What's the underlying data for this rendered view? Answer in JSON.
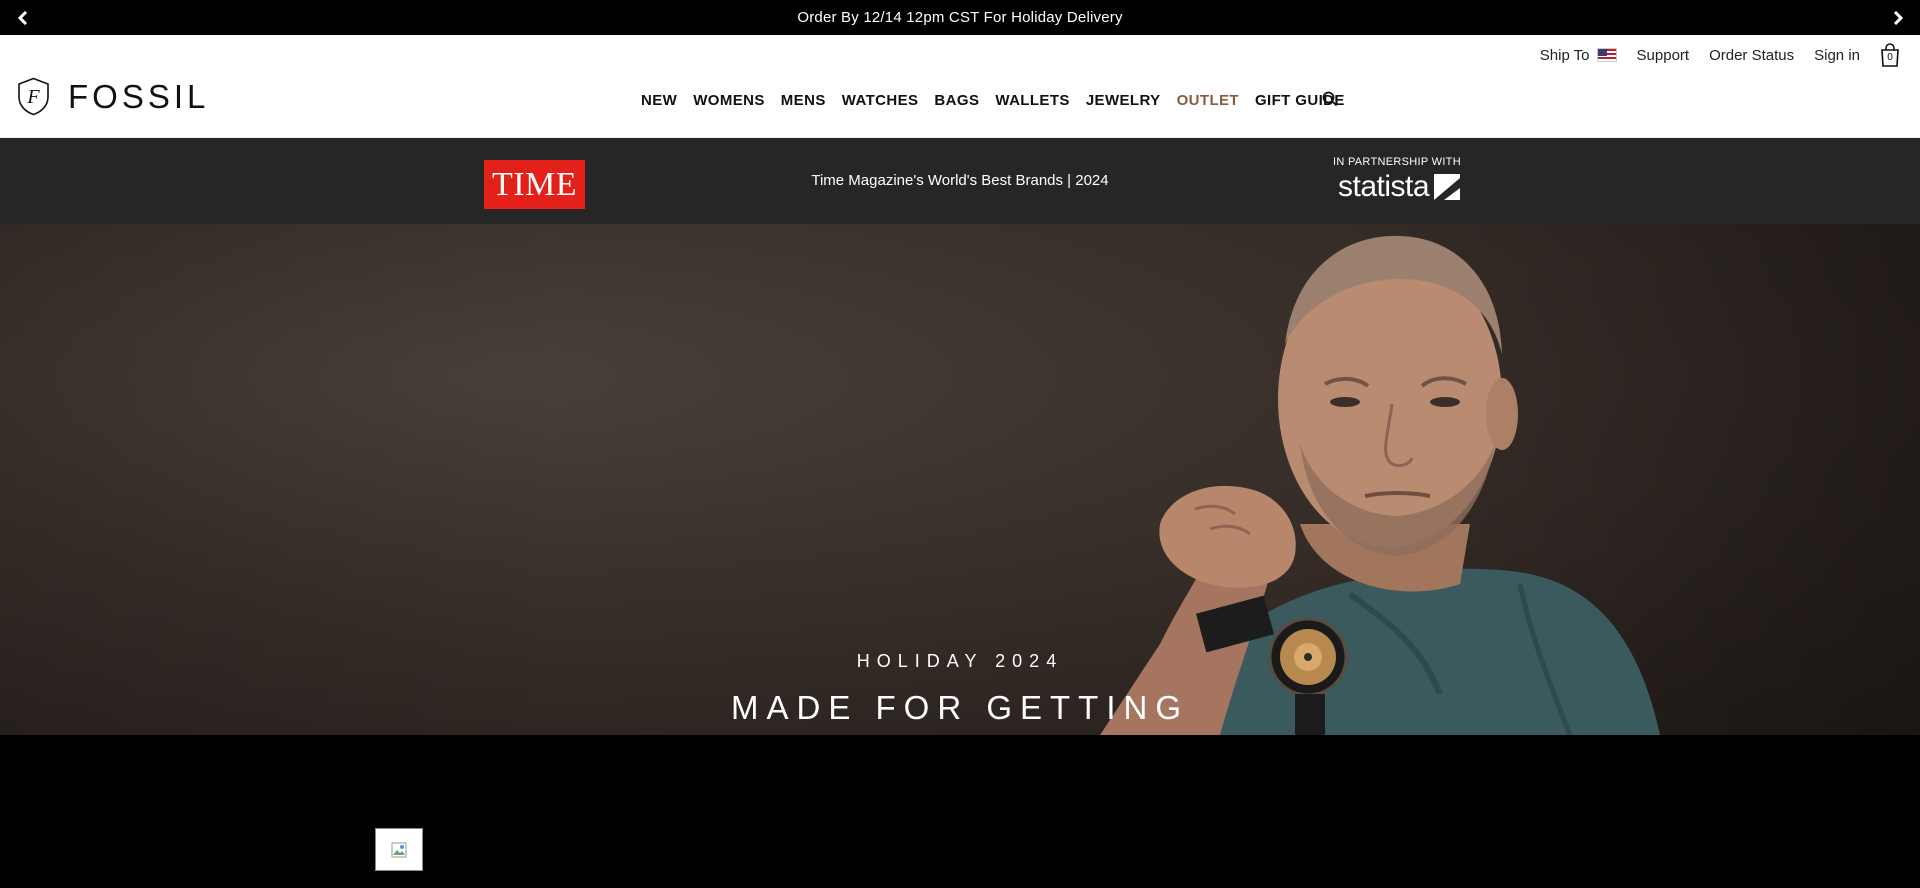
{
  "promo": {
    "message": "Order By 12/14 12pm CST For Holiday Delivery"
  },
  "utility": {
    "ship_to_label": "Ship To",
    "support_label": "Support",
    "order_status_label": "Order Status",
    "sign_in_label": "Sign in",
    "bag_count": "0"
  },
  "brand": {
    "name": "FOSSIL"
  },
  "nav": {
    "items": [
      {
        "label": "NEW"
      },
      {
        "label": "WOMENS"
      },
      {
        "label": "MENS"
      },
      {
        "label": "WATCHES"
      },
      {
        "label": "BAGS"
      },
      {
        "label": "WALLETS"
      },
      {
        "label": "JEWELRY"
      },
      {
        "label": "OUTLET"
      },
      {
        "label": "GIFT GUIDE"
      }
    ]
  },
  "time_banner": {
    "logo_text": "TIME",
    "text": "Time Magazine's World's Best Brands | 2024",
    "partner_label": "IN PARTNERSHIP WITH",
    "partner_name": "statista"
  },
  "hero": {
    "eyebrow": "HOLIDAY 2024",
    "headline": "MADE FOR GETTING"
  },
  "colors": {
    "outlet": "#8b5a3c",
    "time_red": "#e32019",
    "banner_bg": "#262626"
  }
}
